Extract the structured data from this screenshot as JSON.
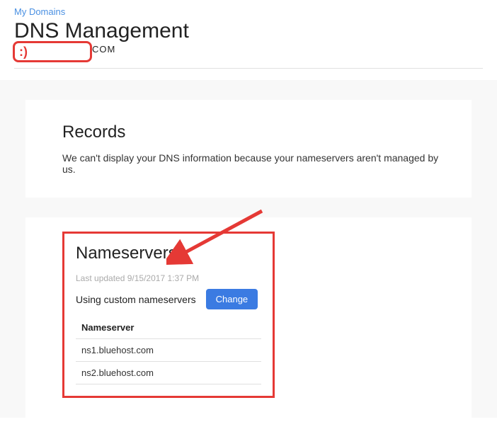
{
  "breadcrumb": {
    "label": "My Domains"
  },
  "page": {
    "title": "DNS Management",
    "domain_smile": ":)",
    "domain_tld": "COM"
  },
  "records": {
    "title": "Records",
    "message": "We can't display your DNS information because your nameservers aren't managed by us."
  },
  "nameservers": {
    "title": "Nameservers",
    "last_updated": "Last updated 9/15/2017 1:37 PM",
    "status": "Using custom nameservers",
    "change_label": "Change",
    "table_header": "Nameserver",
    "entries": [
      "ns1.bluehost.com",
      "ns2.bluehost.com"
    ]
  }
}
